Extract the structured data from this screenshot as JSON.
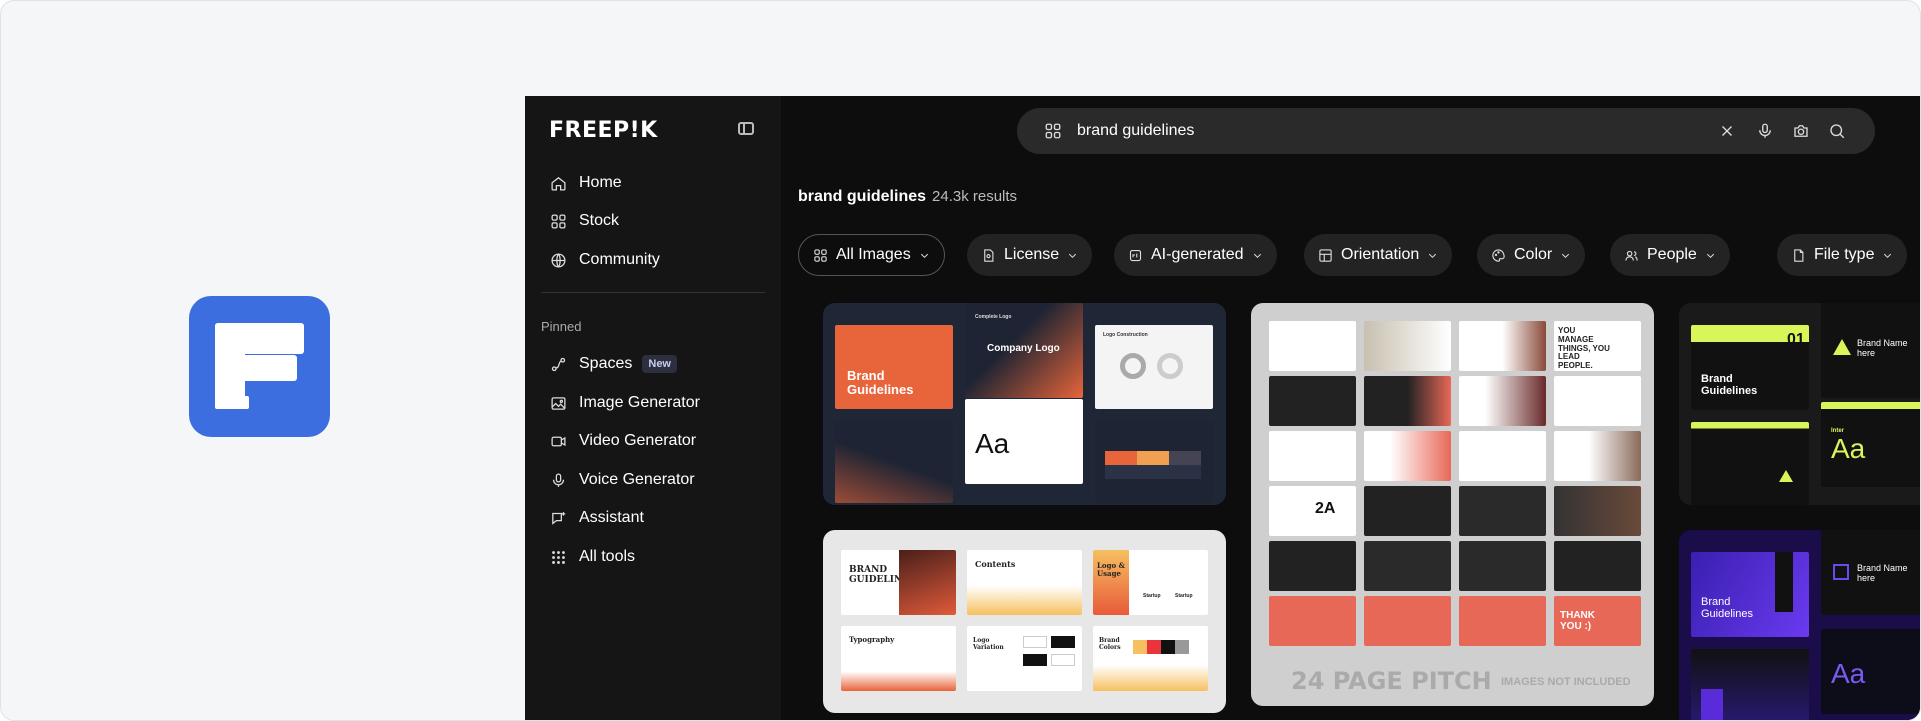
{
  "app": {
    "name": "Freepik"
  },
  "sidebar": {
    "brand": "FREEP!K",
    "nav": [
      {
        "label": "Home",
        "icon": "home-icon"
      },
      {
        "label": "Stock",
        "icon": "stock-icon"
      },
      {
        "label": "Community",
        "icon": "globe-icon"
      }
    ],
    "pinned_label": "Pinned",
    "pinned": [
      {
        "label": "Spaces",
        "icon": "spaces-icon",
        "badge": "New"
      },
      {
        "label": "Image Generator",
        "icon": "image-icon"
      },
      {
        "label": "Video Generator",
        "icon": "video-icon"
      },
      {
        "label": "Voice Generator",
        "icon": "microphone-icon"
      },
      {
        "label": "Assistant",
        "icon": "assistant-icon"
      },
      {
        "label": "All tools",
        "icon": "grid-icon"
      }
    ]
  },
  "search": {
    "value": "brand guidelines",
    "placeholder": "Search"
  },
  "results": {
    "query": "brand guidelines",
    "count": "24.3k results"
  },
  "filters": [
    "All Images",
    "License",
    "AI-generated",
    "Orientation",
    "Color",
    "People",
    "File type"
  ],
  "cards": {
    "card1": {
      "title": "Brand Guidelines",
      "logo_text": "Company Logo",
      "type_sample": "Aa",
      "top_label": "Complete Logo",
      "section_label": "Logo Construction"
    },
    "card2": {
      "t1": "BRAND GUIDELINE",
      "t2": "Contents",
      "t3": "Logo & Usage",
      "t4": "Typography",
      "t5": "Logo Variation",
      "t6": "Brand Colors",
      "sub1": "Startup",
      "sub2": "Startup"
    },
    "card3": {
      "caption": "24 PAGE PITCH",
      "note": "IMAGES NOT INCLUDED",
      "headline": "YOU MANAGE THINGS, YOU LEAD PEOPLE.",
      "thanks": "THANK YOU :)",
      "twoa": "2A"
    },
    "card4": {
      "number": "01",
      "title": "Brand Guidelines",
      "brand_name": "Brand Name here",
      "type_sample": "Aa",
      "font_name": "Inter"
    },
    "card5": {
      "title": "Brand Guidelines",
      "brand_name": "Brand Name here",
      "type_sample": "Aa"
    }
  },
  "colors": {
    "accent_orange": "#e8643a",
    "lime": "#d8f55a",
    "purple": "#5a2bd9",
    "navy": "#1e2433"
  }
}
